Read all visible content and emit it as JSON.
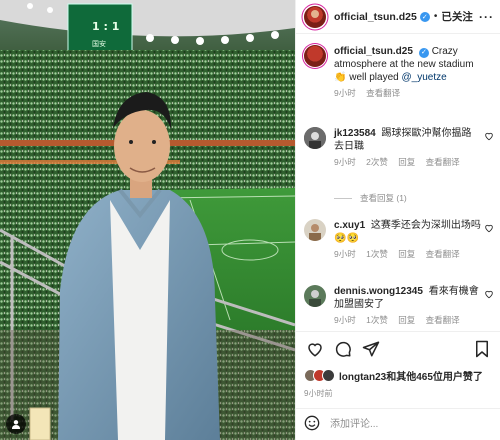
{
  "header": {
    "username": "official_tsun.d25",
    "follow_state": "已关注",
    "more_icon": "more-horizontal-icon"
  },
  "caption": {
    "username": "official_tsun.d25",
    "text_start": "Crazy atmosphere at the new stadium",
    "text_end": "well played",
    "mention": "@_yuetze",
    "time": "9小时",
    "translate": "查看翻译"
  },
  "comments": [
    {
      "username": "jk123584",
      "text": "踢球探歐沖幫你揾路去日職",
      "time": "9小时",
      "likes": "2次赞",
      "reply": "回复",
      "translate": "查看翻译",
      "view_replies": "查看回复 (1)"
    },
    {
      "username": "c.xuy1",
      "text": "这赛季还会为深圳出场吗",
      "emoji": "🥺🥺",
      "time": "9小时",
      "likes": "1次赞",
      "reply": "回复",
      "translate": "查看翻译"
    },
    {
      "username": "dennis.wong12345",
      "text": "看來有機會加盟國安了",
      "time": "9小时",
      "likes": "1次赞",
      "reply": "回复",
      "translate": "查看翻译"
    }
  ],
  "likes_summary": "longtan23和其他465位用户赞了",
  "post_time": "9小时前",
  "add_comment_placeholder": "添加评论...",
  "photo": {
    "scoreboard_score": "1 : 1",
    "scoreboard_label": "国安"
  },
  "colors": {
    "verified": "#3897f0",
    "muted": "#8e8e8e",
    "text": "#262626",
    "mention": "#00376b"
  }
}
